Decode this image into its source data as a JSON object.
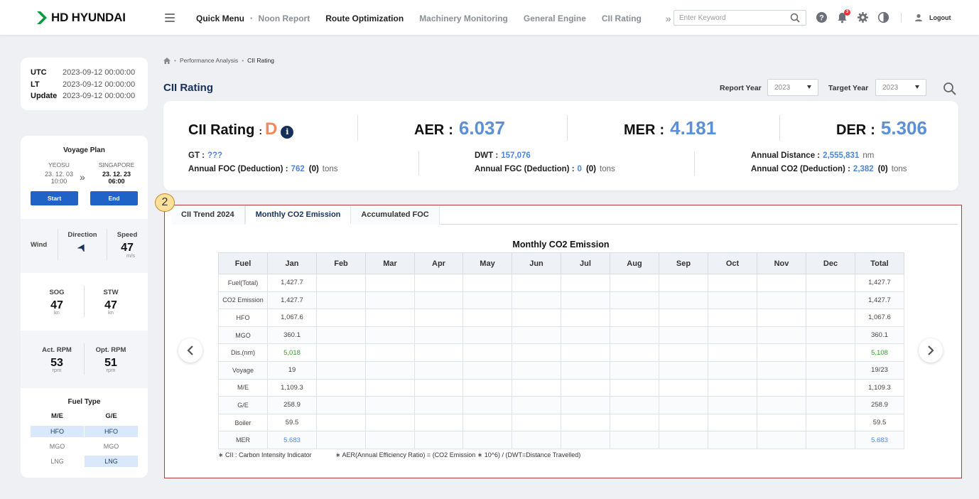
{
  "brand": {
    "name": "HD HYUNDAI"
  },
  "nav": {
    "quick_menu": "Quick Menu",
    "items": [
      "Noon Report",
      "Route Optimization",
      "Machinery Monitoring",
      "General Engine",
      "CII Rating"
    ],
    "more": "»"
  },
  "search": {
    "placeholder": "Enter Keyword"
  },
  "notifications": {
    "count": "3"
  },
  "logout": "Logout",
  "time": {
    "utc_label": "UTC",
    "utc": "2023-09-12 00:00:00",
    "lt_label": "LT",
    "lt": "2023-09-12 00:00:00",
    "update_label": "Update",
    "update": "2023-09-12 00:00:00"
  },
  "voyage": {
    "title": "Voyage Plan",
    "from": "YEOSU",
    "from_date": "23. 12. 03",
    "from_time": "10:00",
    "to": "SINGAPORE",
    "to_date": "23. 12. 23",
    "to_time": "06:00",
    "arrow": "»",
    "start": "Start",
    "end": "End"
  },
  "wind": {
    "label": "Wind",
    "direction_label": "Direction",
    "speed_label": "Speed",
    "speed": "47",
    "speed_unit": "m/s"
  },
  "speed": {
    "sog_label": "SOG",
    "sog": "47",
    "sog_unit": "kn",
    "stw_label": "STW",
    "stw": "47",
    "stw_unit": "kn"
  },
  "rpm": {
    "act_label": "Act. RPM",
    "act": "53",
    "opt_label": "Opt. RPM",
    "opt": "51",
    "unit": "rpm"
  },
  "fuel_type": {
    "title": "Fuel Type",
    "me_label": "M/E",
    "ge_label": "G/E",
    "me": [
      "HFO",
      "MGO",
      "LNG"
    ],
    "ge": [
      "HFO",
      "MGO",
      "LNG"
    ]
  },
  "breadcrumb": {
    "parent": "Performance Analysis",
    "current": "CII Rating"
  },
  "page_title": "CII Rating",
  "filters": {
    "report_year_label": "Report Year",
    "report_year": "2023",
    "target_year_label": "Target Year",
    "target_year": "2023"
  },
  "summary": {
    "cii_label": "CII Rating",
    "cii_grade": "D",
    "aer_label": "AER",
    "aer": "6.037",
    "mer_label": "MER",
    "mer": "4.181",
    "der_label": "DER",
    "der": "5.306",
    "gt_label": "GT :",
    "gt": "???",
    "foc_label": "Annual FOC (Deduction) :",
    "foc": "762",
    "foc_ded": "(0)",
    "foc_unit": "tons",
    "dwt_label": "DWT :",
    "dwt": "157,076",
    "fgc_label": "Annual FGC (Deduction) :",
    "fgc": "0",
    "fgc_ded": "(0)",
    "fgc_unit": "tons",
    "dist_label": "Annual Distance :",
    "dist": "2,555,831",
    "dist_unit": "nm",
    "co2_label": "Annual CO2 (Deduction) :",
    "co2": "2,382",
    "co2_ded": "(0)",
    "co2_unit": "tons"
  },
  "annotation": "2",
  "tabs": [
    "CII Trend 2024",
    "Monthly CO2 Emission",
    "Accumulated FOC"
  ],
  "table": {
    "title": "Monthly CO2 Emission",
    "headers": [
      "Fuel",
      "Jan",
      "Feb",
      "Mar",
      "Apr",
      "May",
      "Jun",
      "Jul",
      "Aug",
      "Sep",
      "Oct",
      "Nov",
      "Dec",
      "Total"
    ],
    "rows": [
      [
        "Fuel(Total)",
        "1,427.7",
        "1,427.7"
      ],
      [
        "CO2 Emission",
        "1,427.7",
        "1,427.7"
      ],
      [
        "HFO",
        "1,067.6",
        "1,067.6"
      ],
      [
        "MGO",
        "360.1",
        "360.1"
      ],
      [
        "Dis.(nm)",
        "5,018",
        "5,108"
      ],
      [
        "Voyage",
        "19",
        "19/23"
      ],
      [
        "M/E",
        "1,109.3",
        "1,109.3"
      ],
      [
        "G/E",
        "258.9",
        "258.9"
      ],
      [
        "Boiler",
        "59.5",
        "59.5"
      ],
      [
        "MER",
        "5.683",
        "5.683"
      ]
    ]
  },
  "footnotes": {
    "cii": "∗ CII : Carbon Intensity Indicator",
    "aer": "∗ AER(Annual Efficiency Ratio) = (CO2 Emission ∗ 10^6) / (DWT=Distance Travelled)"
  },
  "colors": {
    "accent": "#1f63c6",
    "value": "#4d86d9",
    "grade": "#f08a5d",
    "highlight": "#b73a3a"
  }
}
